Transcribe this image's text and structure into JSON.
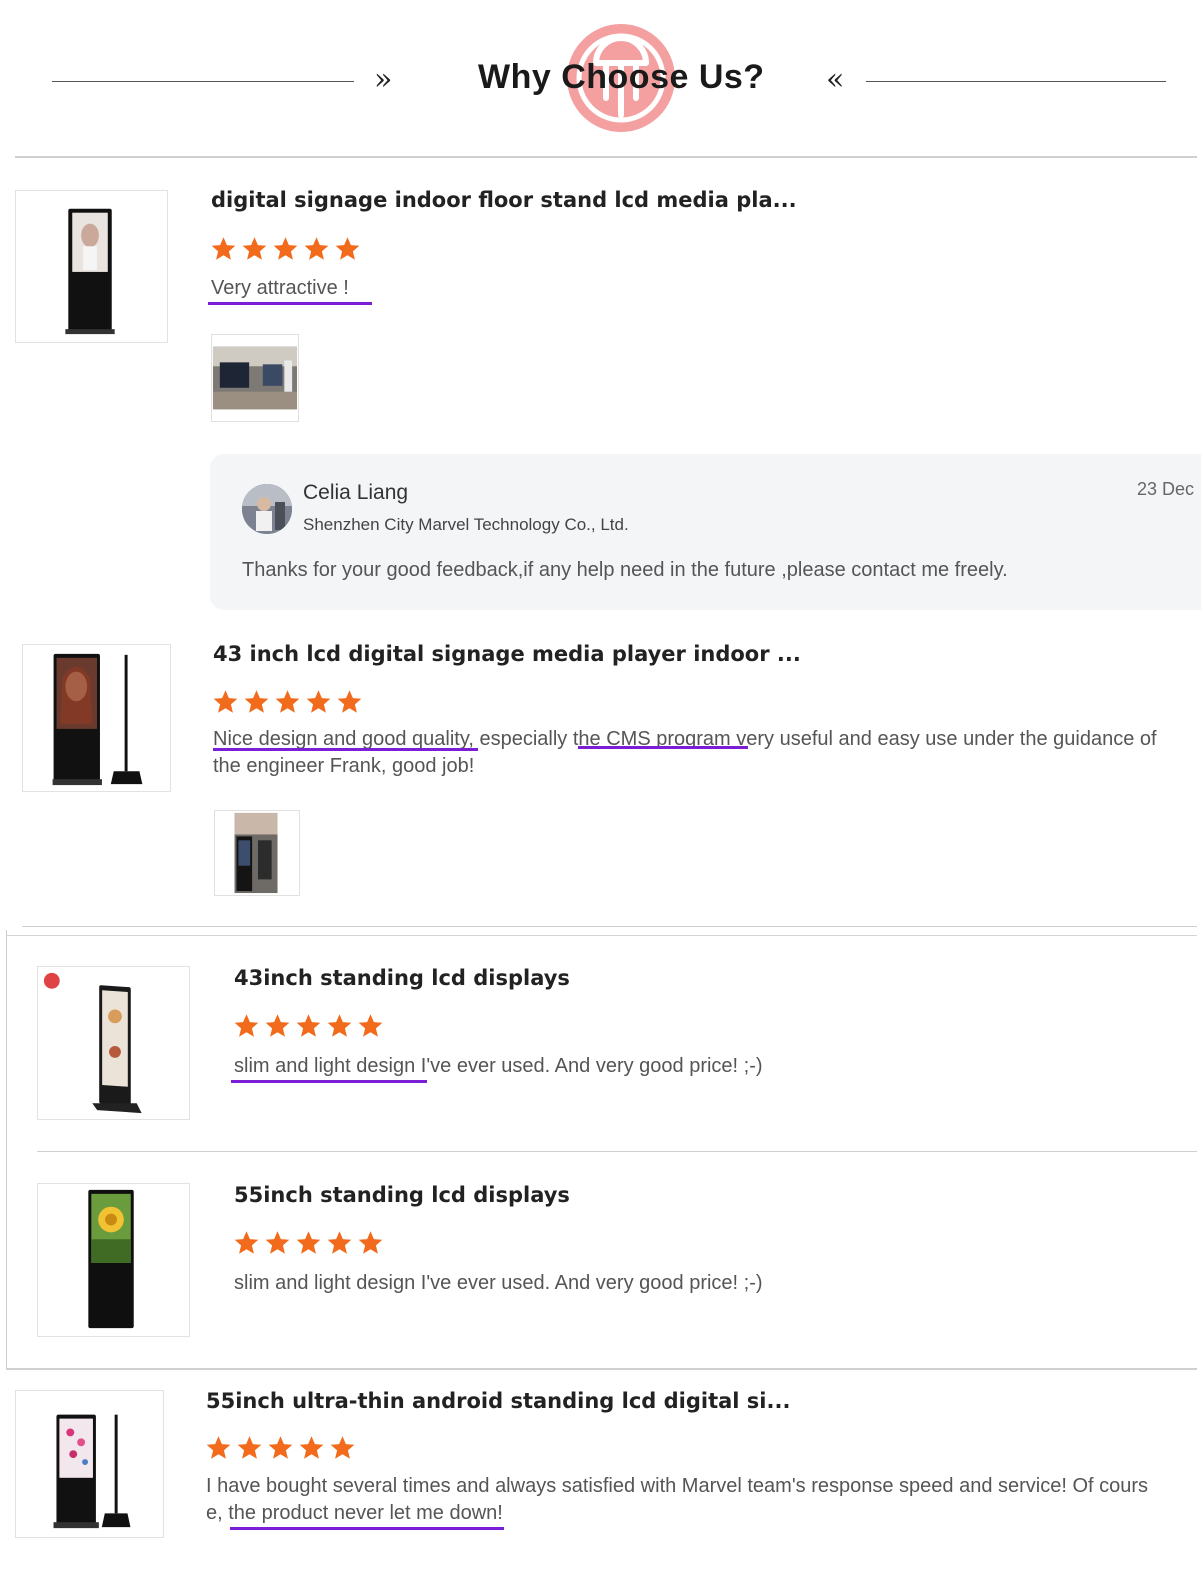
{
  "header": {
    "title": "Why Choose Us?",
    "chevron_right": "»",
    "chevron_left": "«",
    "logo_color": "#f08b8b"
  },
  "colors": {
    "star": "#f26a1b",
    "underline": "#7b1fd6"
  },
  "reviews": [
    {
      "product_title": "digital signage indoor floor stand lcd media pla...",
      "rating": 5,
      "text": "Very attractive !",
      "has_photo": true
    },
    {
      "product_title": "43 inch lcd digital signage media player indoor ...",
      "rating": 5,
      "text_parts": [
        "Nice design and good quality",
        ", especially ",
        "the CMS program ",
        "very useful and easy use under the guidance of"
      ],
      "text_line2": "the engineer Frank, good job!",
      "has_photo": true
    },
    {
      "product_title": "43inch standing lcd displays",
      "rating": 5,
      "text_parts": [
        "slim and light design",
        " I've ever used. And very good price! ;-)"
      ]
    },
    {
      "product_title": "55inch standing lcd displays",
      "rating": 5,
      "text": "slim and light design I've ever used. And very good price! ;-)"
    },
    {
      "product_title": "55inch ultra-thin android standing lcd digital si...",
      "rating": 5,
      "text_line1": "I have bought several times and always satisfied with Marvel team's response speed and service! Of cours",
      "text_line2_prefix": "e, ",
      "text_line2_underlined": "the product never let me down!"
    }
  ],
  "seller_reply": {
    "name": "Celia Liang",
    "company": "Shenzhen City Marvel Technology Co., Ltd.",
    "date": "23 Dec",
    "message": "Thanks for your good feedback,if any help  need in the future ,please contact me freely."
  }
}
